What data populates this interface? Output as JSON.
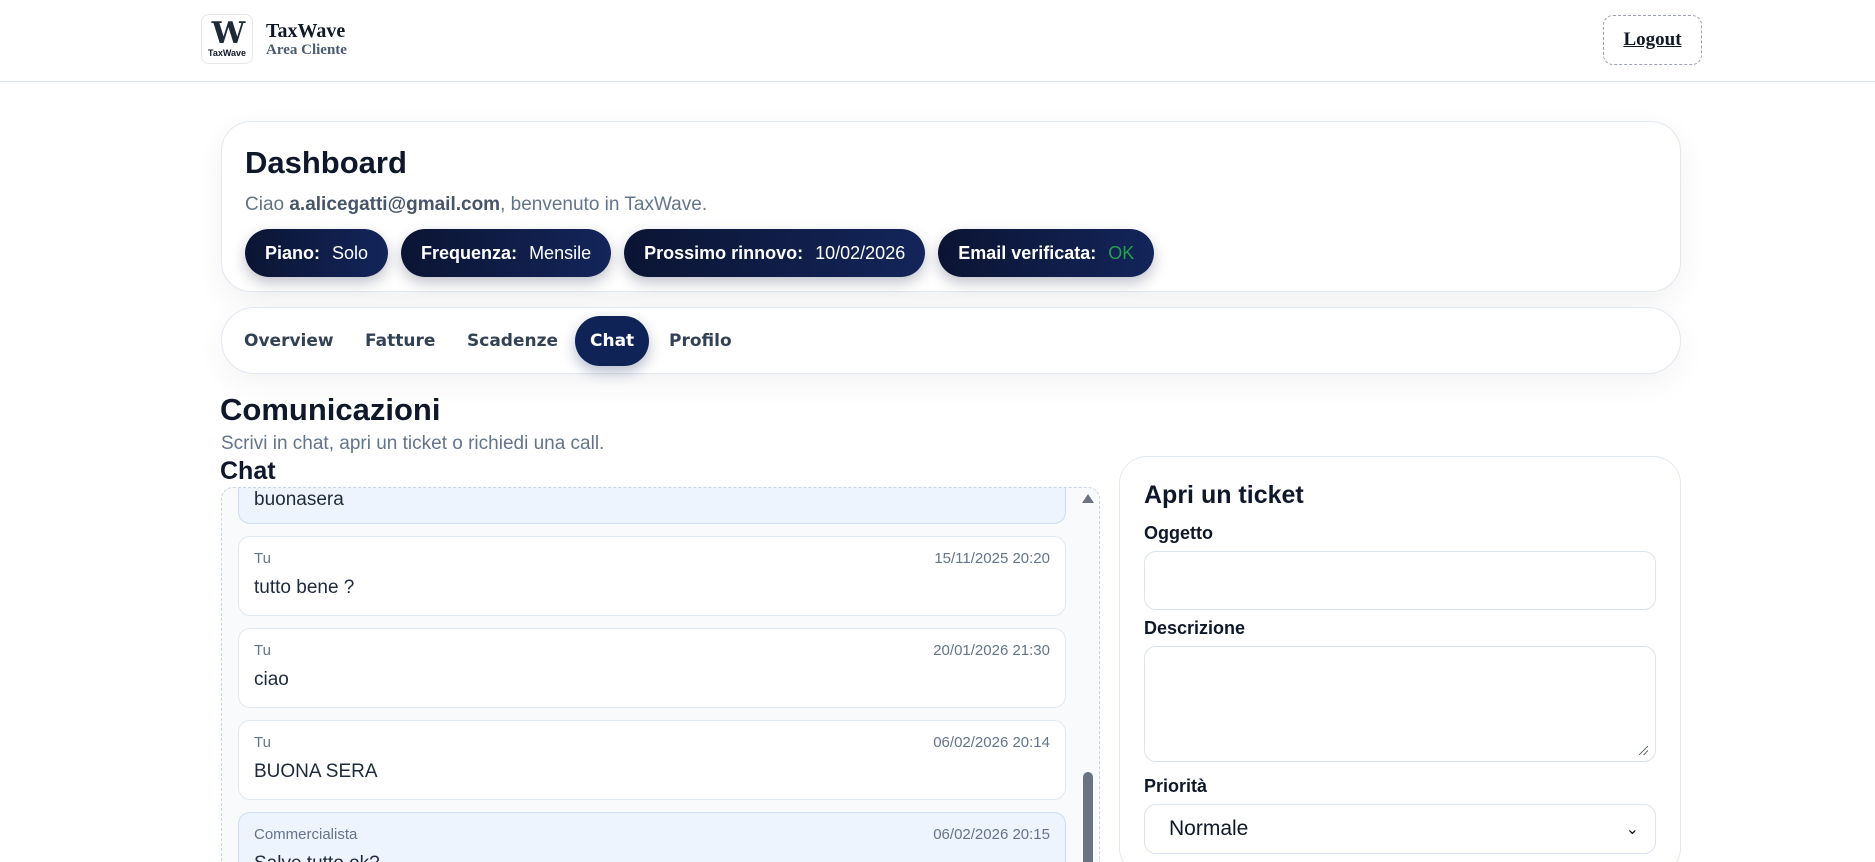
{
  "brand": {
    "logo_glyph": "W",
    "logo_small": "TaxWave",
    "name": "TaxWave",
    "subtitle": "Area Cliente"
  },
  "header": {
    "logout_label": "Logout"
  },
  "dashboard": {
    "title": "Dashboard",
    "greeting_prefix": "Ciao ",
    "email": "a.alicegatti@gmail.com",
    "greeting_suffix": ", benvenuto in TaxWave.",
    "pills": [
      {
        "key": "Piano:",
        "value": "Solo"
      },
      {
        "key": "Frequenza:",
        "value": "Mensile"
      },
      {
        "key": "Prossimo rinnovo:",
        "value": "10/02/2026"
      },
      {
        "key": "Email verificata:",
        "value": "OK"
      }
    ],
    "ok_color": "#22a04b"
  },
  "tabs": [
    {
      "label": "Overview",
      "active": false
    },
    {
      "label": "Fatture",
      "active": false
    },
    {
      "label": "Scadenze",
      "active": false
    },
    {
      "label": "Chat",
      "active": true
    },
    {
      "label": "Profilo",
      "active": false
    }
  ],
  "section": {
    "title": "Comunicazioni",
    "subtitle": "Scrivi in chat, apri un ticket o richiedi una call.",
    "chat_title": "Chat"
  },
  "chat": {
    "messages": [
      {
        "who": "",
        "when": "",
        "text": "buonasera",
        "from_pro": true
      },
      {
        "who": "Tu",
        "when": "15/11/2025 20:20",
        "text": "tutto bene ?",
        "from_pro": false
      },
      {
        "who": "Tu",
        "when": "20/01/2026 21:30",
        "text": "ciao",
        "from_pro": false
      },
      {
        "who": "Tu",
        "when": "06/02/2026 20:14",
        "text": "BUONA SERA",
        "from_pro": false
      },
      {
        "who": "Commercialista",
        "when": "06/02/2026 20:15",
        "text": "Salve tutto ok?",
        "from_pro": true
      }
    ]
  },
  "ticket": {
    "title": "Apri un ticket",
    "subject_label": "Oggetto",
    "subject_value": "",
    "description_label": "Descrizione",
    "description_value": "",
    "priority_label": "Priorità",
    "priority_value": "Normale"
  }
}
